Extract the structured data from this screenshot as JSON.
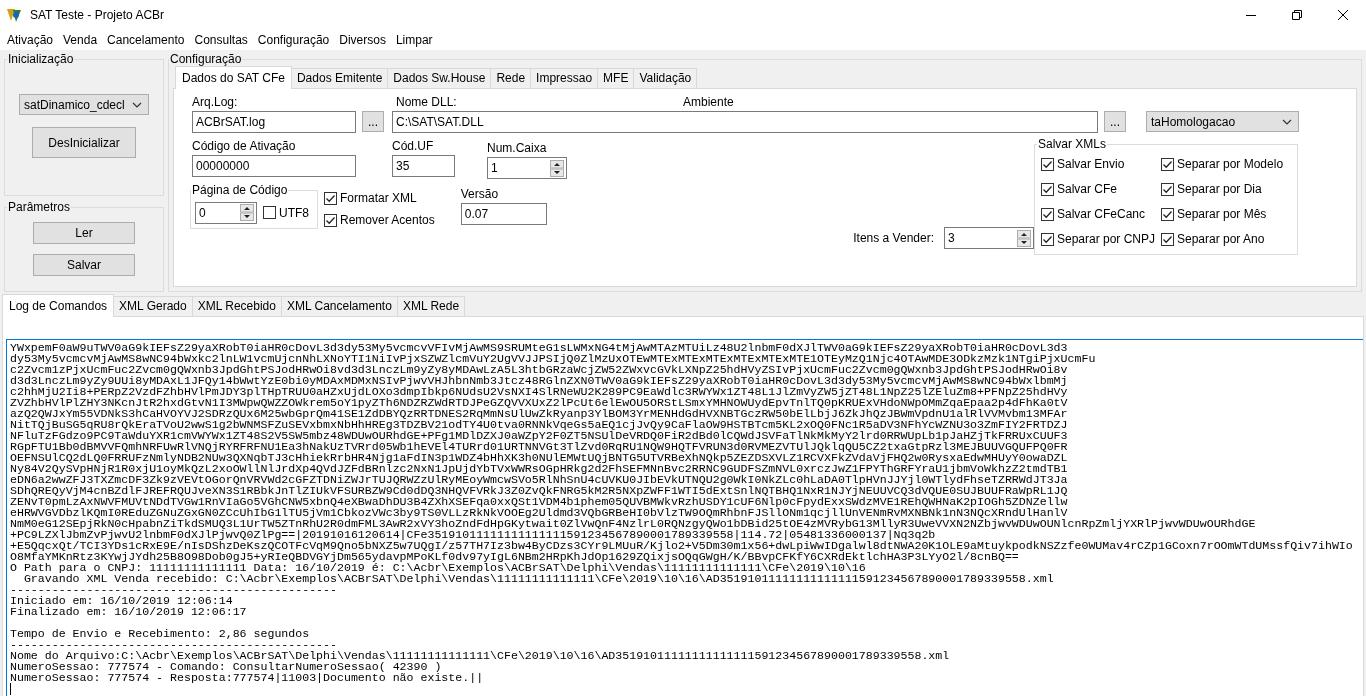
{
  "window": {
    "title": "SAT Teste - Projeto ACBr"
  },
  "menu": [
    "Ativação",
    "Venda",
    "Cancelamento",
    "Consultas",
    "Configuração",
    "Diversos",
    "Limpar"
  ],
  "inicializacao": {
    "title": "Inicialização",
    "library": "satDinamico_cdecl",
    "button": "DesInicializar"
  },
  "parametros": {
    "title": "Parâmetros",
    "buttons": [
      "Ler",
      "Salvar"
    ]
  },
  "configuracao": {
    "title": "Configuração",
    "tabs": [
      {
        "label": "Dados do SAT CFe",
        "selected": true
      },
      {
        "label": "Dados Emitente",
        "selected": false
      },
      {
        "label": "Dados Sw.House",
        "selected": false
      },
      {
        "label": "Rede",
        "selected": false
      },
      {
        "label": "Impressao",
        "selected": false
      },
      {
        "label": "MFE",
        "selected": false
      },
      {
        "label": "Validação",
        "selected": false
      }
    ],
    "arq_log": {
      "label": "Arq.Log:",
      "value": "ACBrSAT.log",
      "browse": "..."
    },
    "nome_dll": {
      "label": "Nome DLL:",
      "value": "C:\\SAT\\SAT.DLL",
      "browse": "..."
    },
    "ambiente": {
      "label": "Ambiente",
      "value": "taHomologacao"
    },
    "codigo_ativacao": {
      "label": "Código de Ativação",
      "value": "00000000"
    },
    "cod_uf": {
      "label": "Cód.UF",
      "value": "35"
    },
    "num_caixa": {
      "label": "Num.Caixa",
      "value": "1"
    },
    "pagina_codigo": {
      "title": "Página de Código",
      "value": "0",
      "utf8": {
        "label": "UTF8",
        "checked": false
      }
    },
    "options": [
      {
        "label": "Formatar XML",
        "checked": true
      },
      {
        "label": "Remover Acentos",
        "checked": true
      }
    ],
    "versao": {
      "label": "Versão",
      "value": "0.07"
    },
    "itens_vender": {
      "label": "Itens a Vender:",
      "value": "3"
    },
    "salvar_xmls": {
      "title": "Salvar XMLs",
      "items": [
        {
          "label": "Salvar Envio",
          "checked": true
        },
        {
          "label": "Separar por Modelo",
          "checked": true
        },
        {
          "label": "Salvar CFe",
          "checked": true
        },
        {
          "label": "Separar por Dia",
          "checked": true
        },
        {
          "label": "Salvar CFeCanc",
          "checked": true
        },
        {
          "label": "Separar por Mês",
          "checked": true
        },
        {
          "label": "Separar por CNPJ",
          "checked": true
        },
        {
          "label": "Separar por Ano",
          "checked": true
        }
      ]
    }
  },
  "log_tabs": [
    {
      "label": "Log de Comandos",
      "selected": true
    },
    {
      "label": "XML Gerado",
      "selected": false
    },
    {
      "label": "XML Recebido",
      "selected": false
    },
    {
      "label": "XML Cancelamento",
      "selected": false
    },
    {
      "label": "XML Rede",
      "selected": false
    }
  ],
  "log": [
    {
      "kind": "line",
      "text": "YWxpemF0aW9uTWV0aG9kIEFsZ29yaXRobT0iaHR0cDovL3d3dy53My5vcmcvVFIvMjAwMS9SRUMteG1sLWMxNG4tMjAwMTAzMTUiLz48U2lnbmF0dXJlTWV0aG9kIEFsZ29yaXRobT0iaHR0cDovL3d3"
    },
    {
      "kind": "line",
      "text": "dy53My5vcmcvMjAwMS8wNC94bWxkc2lnLW1vcmUjcnNhLXNoYTI1NiIvPjxSZWZlcmVuY2UgVVJJPSIjQ0ZlMzUxOTEwMTExMTExMTExMTExMTExMTE1OTEyMzQ1Njc4OTAwMDE3ODkzMzk1NTgiPjxUcmFu"
    },
    {
      "kind": "line",
      "text": "c2Zvcm1zPjxUcmFuc2Zvcm0gQWxnb3JpdGhtPSJodHRwOi8vd3d3LnczLm9yZy8yMDAwLzA5L3htbGRzaWcjZW52ZWxvcGVkLXNpZ25hdHVyZSIvPjxUcmFuc2Zvcm0gQWxnb3JpdGhtPSJodHRwOi8v"
    },
    {
      "kind": "line",
      "text": "d3d3LnczLm9yZy9UUi8yMDAxL1JFQy14bWwtYzE0bi0yMDAxMDMxNSIvPjwvVHJhbnNmb3Jtcz48RGlnZXN0TWV0aG9kIEFsZ29yaXRobT0iaHR0cDovL3d3dy53My5vcmcvMjAwMS8wNC94bWxlbmMj"
    },
    {
      "kind": "line",
      "text": "c2hhMjU2Ii8+PERpZ2VzdFZhbHVlPmJDY3plTHpTRUU0aHZxUjdLOXo3dmpIbkp6NUdsU2VsNXI4SlRNeWU2K289PC9EaWdlc3RWYWx1ZT48L1JlZmVyZW5jZT48L1NpZ25lZEluZm8+PFNpZ25hdHVy"
    },
    {
      "kind": "line",
      "text": "ZVZhbHVlPlZHY3NKcnJtR2hxdGtvN1I3MWpwQWZZOWkrem5oY1pyZTh6NDZRZWdRTDJPeGZQVVXUxZ2lPcUt6elEwOU5ORStLSmxYMHNOWUydEpvTnlTQ0pKRUExVHdoNWpOMmZqaEpaa2p4dFhKa0tV"
    },
    {
      "kind": "line",
      "text": "azQ2QWJxYm55VDNkS3hCaHVOYVJ2SDRzQUx6M25wbGprQm41SE1ZdDBYQzRRTDNES2RqMmNsUlUwZkRyanp3YlBOM3YrMENHdGdHVXNBTGczRW50bElLbjJ6ZkJhQzJBWmVpdnU1alRlVVMvbm13MFAr"
    },
    {
      "kind": "line",
      "text": "NitTQjBuSG5qRU8rQkEraTVoU2wwS1g2bWNMSFZuSEVxbmxNbHhHREg3TDZBV21odTY4U0tva0RNNkVqeGs5aEQ1cjJvQy9CaFlaOW9HSTBTcm5KL2xOQ0FNc1R5aDV3NFhYcWZNU3o3ZmFIY2FRTDZJ"
    },
    {
      "kind": "line",
      "text": "NFluTzFGdzo9PC9TaWduYXR1cmVWYWx1ZT48S2V5SW5mbz48WDUwOURhdGE+PFg1MDlDZXJ0aWZpY2F0ZT5NSUlDeVRDQ0FiR2dBd0lCQWdJSVFaTlNkMkMyY2lrd0RRWUpLb1pJaHZjTkFRRUxCUUF3"
    },
    {
      "kind": "line",
      "text": "RGpFTU1Bb0dBMVVFQmhNRFUwRlVNQjRYRFRFNU1Ea3hNakUzTVRrd05Wb1hEVEl4TURrd01URTNNVGt3TlZvd0RqRU1NQW9HQTFVRUN3d0RVMEZVTUlJQklqQU5CZ2txaGtpRzl3MEJBUUVGQUFPQ0FR"
    },
    {
      "kind": "line",
      "text": "OEFNSUlCQ2dLQ0FRRUFzNmlyNDB2NUw3QXNqbTJ3cHhiekRrbHR4Njg1aFdIN3p1WDZ4bHhXK3h0NUlEMWtUQjBNTG5UTVRBeXhNQkp5ZEZDSXVLZ1RCVXFkZVdaVjFHQ2w0RysxaEdwMHUyY0owaDZL"
    },
    {
      "kind": "line",
      "text": "Ny84V2QySVpHNjR1R0xjU1oyMkQzL2xoOWllNlJrdXp4QVdJZFdBRnlzc2NxN1JpUjdYbTVxWWRsOGpHRkg2d2FhSEFMNnBvc2RRNC9GUDFSZmNVL0xrczJwZ1FPYThGRFYraU1jbmVoWkhzZ2tmdTB1"
    },
    {
      "kind": "line",
      "text": "eDN6a2wwZFJ3TXZmcDF3Zk9zVEVtOGorQnVRVWd2cGFZTDNiZWJrTUJQRWZzUlRyMEoyWmcwSVo5RlNhSnU4cUVKU0JIbEVkUTNQU2g0WkI0NkZLc0hLaDA0TlpHVnJJYjl0WTlydFhseTZRRWdJT3Ja"
    },
    {
      "kind": "line",
      "text": "SDhQREQyVjM4cnBZdlFJREFRQUJveXN3S1RBbkJnTlZIUkVFSURBZW9Cd0dDQ3NHQVFVRkJ3Z0ZvQkFNRG5kM2R5NXpZWFF1WTI5dExtSnlNQTBHQ1NxR1NJYjNEUUVCQ3dVQUE0SUJBUUFRaWpRL1JQ"
    },
    {
      "kind": "line",
      "text": "ZENvT0pmLzAxNWVFMUVtNDdTVGw1RnVIaGo5VGhCNW5xbnQ4eXBwaDhDU3B4ZXhXSEFqa0xxQSt1VDM4b1phem05QUVBMWkvRzhUSDY1cUF6Nlp0cFpydExxSWdzMVE1REhQWHNaK2pIOGh5ZDNZellw"
    },
    {
      "kind": "line",
      "text": "eHRWVGVDbzlKQmI0REduZGNuZGxGN0ZCcUhIbG1lTU5jVm1CbkozVWc3by9TS0VLLzRkNkVOOEg2Uldmd3VQbGRBeHI0bVlzTW9OQmRhbnFJSllONm1qcjllUnVENmRvMXNBNk1nN3NQcXRndUlHanlV"
    },
    {
      "kind": "line",
      "text": "NmM0eG12SEpjRkN0cHpabnZiTkdSMUQ3L1UrTW5ZTnRhU2R0dmFML3AwR2xVY3hoZndFdHpGKytwait0ZlVwQnF4NzlrL0RQNzgyQWo1bDBid25tOE4zMVRybG13MllyR3UweVVXN2NZbjwvWDUwOUNlcnRpZmljYXRlPjwvWDUwOURhdGE"
    },
    {
      "kind": "line",
      "text": "+PC9LZXlJbmZvPjwvU2lnbmF0dXJlPjwvQ0ZlPg==|20191016120614|CFe35191011111111111111591234567890001789339558|114.72|05481336000137|Nq3q2b"
    },
    {
      "kind": "line",
      "text": "+E5QqcxQt/TCI3YDs1cRxE9E/nIsDShzDeKszQCOTFcVqM9Qno5bNXZ5w7UQgI/z57TH7Iz3bw4ByCDzs3CYr9LMUuR/Kjlo2+V5Dm30m1x56+dwLpiWwIDgalwl8dtNWA20K1OLE9aMtuykpodkNSZzfe0WUMav4rCZp1GCoxn7rOOmWTdUMssfQiv7ihWIo"
    },
    {
      "kind": "line",
      "text": "O8MfaYMKnRtz3KYwjJYdh25B8O98Dob0gJ5+yRIeQBDVGYjDm565ydavpMPoKLf0dv97yIgL6NBm2HRpKhJdOp1629ZQixjsOQqGWgH/K/BBvpCFKfY6CXRdEktlchHA3P3LYyO2l/8cnBQ=="
    },
    {
      "kind": "line",
      "text": "O Path para o CNPJ: 11111111111111 Data: 16/10/2019 é: C:\\Acbr\\Exemplos\\ACBrSAT\\Delphi\\Vendas\\11111111111111\\CFe\\2019\\10\\16"
    },
    {
      "kind": "line",
      "text": "  Gravando XML Venda recebido: C:\\Acbr\\Exemplos\\ACBrSAT\\Delphi\\Vendas\\11111111111111\\CFe\\2019\\10\\16\\AD35191011111111111111591234567890001789339558.xml"
    },
    {
      "kind": "line",
      "text": "-----------------------------------------------"
    },
    {
      "kind": "line",
      "text": "Iniciado em: 16/10/2019 12:06:14"
    },
    {
      "kind": "line",
      "text": "Finalizado em: 16/10/2019 12:06:17"
    },
    {
      "kind": "blank"
    },
    {
      "kind": "line",
      "text": "Tempo de Envio e Recebimento: 2,86 segundos"
    },
    {
      "kind": "line",
      "text": "-----------------------------------------------"
    },
    {
      "kind": "line",
      "text": "Nome do Arquivo:C:\\Acbr\\Exemplos\\ACBrSAT\\Delphi\\Vendas\\11111111111111\\CFe\\2019\\10\\16\\AD35191011111111111111591234567890001789339558.xml"
    },
    {
      "kind": "line",
      "text": "NumeroSessao: 777574 - Comando: ConsultarNumeroSessao( 42390 )"
    },
    {
      "kind": "line",
      "text": "NumeroSessao: 777574 - Resposta:777574|11003|Documento não existe.||"
    }
  ]
}
